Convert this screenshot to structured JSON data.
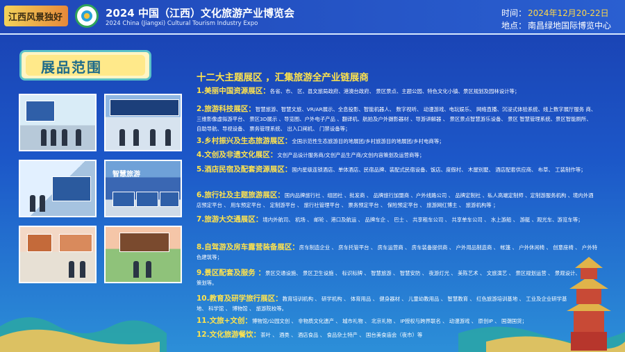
{
  "header": {
    "logo_text": "江西风景独好",
    "title_cn": "2024 中国（江西）文化旅游产业博览会",
    "title_en": "2024 China (Jiangxi) Cultural Tourism Industry Expo",
    "time_label": "时间：",
    "time_value": "2024年12月20-22日",
    "place_label": "地点：",
    "place_value": "南昌绿地国际博览中心"
  },
  "badge": {
    "label": "展品范围"
  },
  "photos": [
    {
      "name": "photo-exhibition-1",
      "text": ""
    },
    {
      "name": "photo-exhibition-2",
      "text": ""
    },
    {
      "name": "photo-exhibition-3",
      "text": ""
    },
    {
      "name": "photo-smart-tourism",
      "text": "智慧旅游"
    },
    {
      "name": "photo-exhibition-5",
      "text": ""
    },
    {
      "name": "photo-exhibition-6",
      "text": ""
    }
  ],
  "heading": "十二大主题展区 ，汇集旅游全产业链展商",
  "entries": [
    {
      "title": "1.美丽中国资源展区：",
      "body": "各省、市、 区、县文旅局政府、港澳台政府、 景区景点、主题公园、特色文化小镇、景区规划及园林设计等；"
    },
    {
      "title": "2.旅游科技展区：",
      "body": "智慧旅游、智慧文旅、VR/AR展示、全息投影、智能机器人、 数字视听、 动漫游戏、电玩娱乐、 网络直播、沉浸式体验系统、线上数字展厅服务 商、 三维影像虚拟游平台、 景区3D展示 、导览图、户外电子产品 、翻译机、航拍及户外摄影器材 、导游讲解器 、 景区景点智慧游乐设备、 景区 智慧管理系统、景区智能厕所、 自助导航、导视设备、 票务管理系统、 出入口闸机、 门禁设备等；"
    },
    {
      "title": "3.乡村振兴及生态旅游展区：",
      "body": "全国示范性生态旅游目的地展团/乡村旅游目的地展团/乡村电商等；"
    },
    {
      "title": "4.文创及非遗文化展区：",
      "body": "文创产品设计服务商/文创产品生产商/文创内容策划及运营商等；"
    },
    {
      "title": "5.酒店民宿及配套资源展区：",
      "body": "国内星级连锁酒店、单体酒店、民宿品牌、装配式民宿设备、饭店、度假村、 木屋别墅、 酒店配套供应商、 布草、 工装制作等；"
    },
    {
      "title": "6.旅行社及主题旅游展区：",
      "body": "国内品牌旅行社 、组团社 、批发商 、 品牌旅行加盟商 、户外线路公司 、 品牌定制社 、私人高端定制师 、定制游服务机构 、境内外酒店预定平台 、 用车预定平台 、 定制游平台 、 旅行社管理平台 、 票务预定平台 、 保险预定平台 、 旅游网红博主 、 旅游机构等 ；"
    },
    {
      "title": "7.旅游大交通展区：",
      "body": "境内外航司、 机场 、 邮轮 、港口及航运 、 品牌车企 、 巴士 、 共享租车公司 、 共享单车公司 、 水上游船 、 游艇 、观光车、游览车等；"
    },
    {
      "title": "8.自驾游及房车露营装备展区：",
      "body": "房车制造企业 、 房车托管平台 、 房车运营商 、 房车装备提供商 、 户外用品制造商 、 帐篷 、 户外休闲椅 、 创意座椅 、 户外特色建筑等；"
    },
    {
      "title": "9.景区配套及服务 ：",
      "body": "景区交通设施、 景区卫生设施 、 标识标牌 、 智慧旅游 、 智慧安防 、 夜游灯光 、 美陈艺术 、 文旅演艺 、 景区规划运营 、 景观设计、 活 动策划等。"
    },
    {
      "title": "10.教育及研学旅行展区：",
      "body": "教育培训机构 、 研学机构 、 体育用品 、 健身器材 、 儿童幼教用品 、 智慧教育 、 红色旅游培训基地 、 工业及企业研学基地、 科学馆 、 博物馆 、 旅游院校等。"
    },
    {
      "title": "11.文旅+文创：",
      "body": "博物馆/公园文创 、 非物质文化遗产 、 城市礼物 、 北京礼物 、 IP授权与跨界联名 、 动漫游戏 、 原创IP 、 国潮国货；"
    },
    {
      "title": "12.文化旅游餐饮：",
      "body": "茶叶 、 酒类 、 酒店食品 、 食品杂土特产 、 国台美食庙会（夜市）等"
    }
  ],
  "colors": {
    "accent": "#ffe34d",
    "background": "#1c57c8",
    "badge_border": "#5bc2c8"
  }
}
